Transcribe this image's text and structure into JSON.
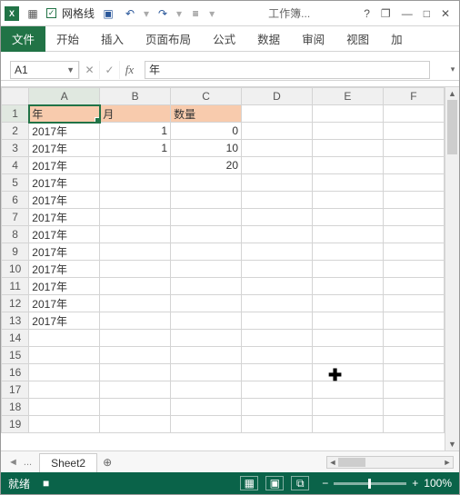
{
  "titlebar": {
    "app_icon_text": "X",
    "gridlines_label": "网格线",
    "workbook_title": "工作簿...",
    "help": "?",
    "restore": "❐",
    "min": "—",
    "max": "□",
    "close": "✕"
  },
  "ribbon": {
    "tabs": [
      "文件",
      "开始",
      "插入",
      "页面布局",
      "公式",
      "数据",
      "审阅",
      "视图",
      "加"
    ]
  },
  "formula_bar": {
    "name_box": "A1",
    "cancel": "✕",
    "confirm": "✓",
    "fx": "fx",
    "value": "年"
  },
  "grid": {
    "columns": [
      "A",
      "B",
      "C",
      "D",
      "E",
      "F"
    ],
    "rows": [
      1,
      2,
      3,
      4,
      5,
      6,
      7,
      8,
      9,
      10,
      11,
      12,
      13,
      14,
      15,
      16,
      17,
      18,
      19
    ],
    "header_row": {
      "A": "年",
      "B": "月",
      "C": "数量"
    },
    "data": [
      {
        "A": "2017年",
        "B": "1",
        "C": "0"
      },
      {
        "A": "2017年",
        "B": "1",
        "C": "10"
      },
      {
        "A": "2017年",
        "B": "",
        "C": "20"
      },
      {
        "A": "2017年",
        "B": "",
        "C": ""
      },
      {
        "A": "2017年",
        "B": "",
        "C": ""
      },
      {
        "A": "2017年",
        "B": "",
        "C": ""
      },
      {
        "A": "2017年",
        "B": "",
        "C": ""
      },
      {
        "A": "2017年",
        "B": "",
        "C": ""
      },
      {
        "A": "2017年",
        "B": "",
        "C": ""
      },
      {
        "A": "2017年",
        "B": "",
        "C": ""
      },
      {
        "A": "2017年",
        "B": "",
        "C": ""
      },
      {
        "A": "2017年",
        "B": "",
        "C": ""
      }
    ],
    "active_cell": "A1"
  },
  "sheet_tabs": {
    "nav_prev": "◄",
    "nav_more": "...",
    "active": "Sheet2",
    "add": "⊕"
  },
  "statusbar": {
    "ready": "就绪",
    "extra": "■",
    "zoom_minus": "−",
    "zoom_plus": "+",
    "zoom_value": "100%"
  }
}
